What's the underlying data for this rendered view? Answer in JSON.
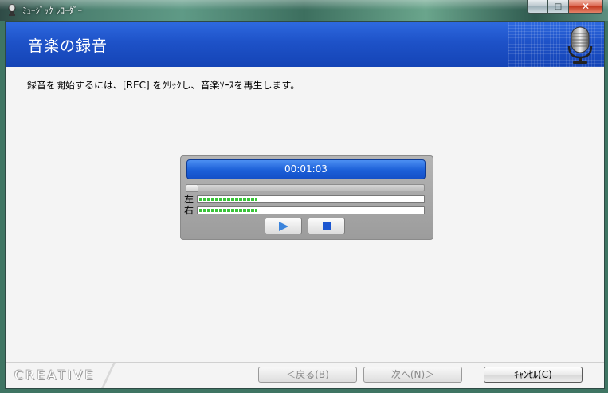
{
  "window": {
    "title": "ﾐｭｰｼﾞｯｸ ﾚｺｰﾀﾞｰ",
    "minimize_glyph": "─",
    "maximize_glyph": "□",
    "close_glyph": "✕"
  },
  "header": {
    "title": "音楽の録音"
  },
  "instruction": "録音を開始するには、[REC] をｸﾘｯｸし、音楽ｿｰｽを再生します。",
  "recorder": {
    "time": "00:01:03",
    "seek_progress": 0.0,
    "left_label": "左",
    "right_label": "右",
    "left_level": 0.26,
    "right_level": 0.26,
    "play_icon": "play-icon",
    "stop_icon": "stop-icon"
  },
  "footer": {
    "logo": "CREATIVE",
    "back_button": "＜戻る(B)",
    "next_button": "次へ(N)＞",
    "cancel_button": "ｷｬﾝｾﾙ(C)"
  },
  "colors": {
    "banner": "#1e52c8",
    "display": "#1b5fd8",
    "meter_green": "#38c438"
  }
}
